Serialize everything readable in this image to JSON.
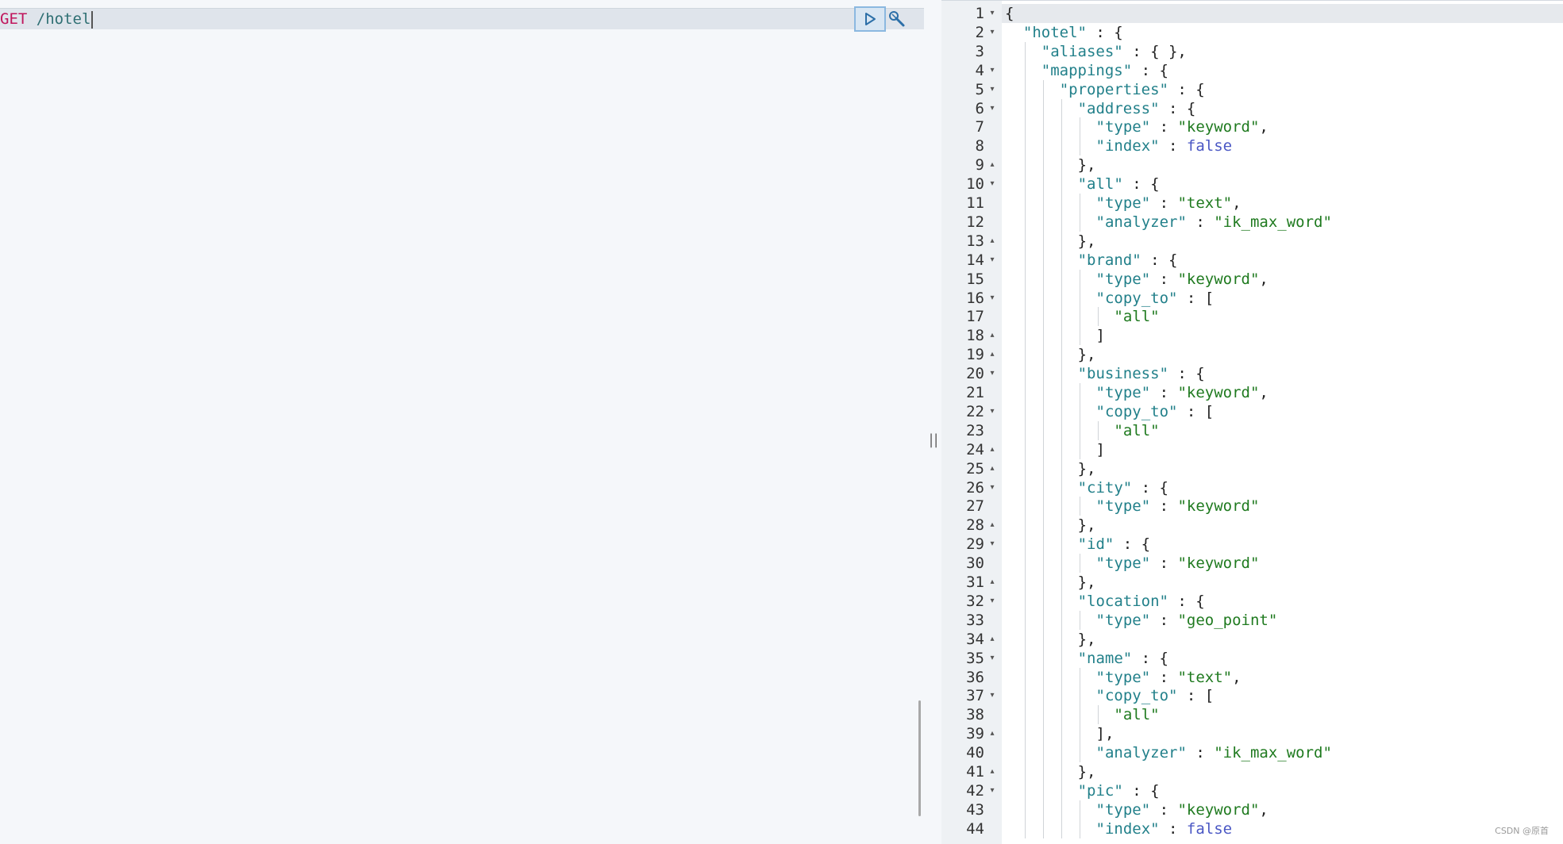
{
  "request": {
    "method": "GET",
    "path": "/hotel"
  },
  "toolbar": {
    "run_icon": "play-icon",
    "settings_icon": "wrench-icon"
  },
  "splitter": {
    "grip": "||"
  },
  "response": {
    "lines": [
      {
        "n": "1",
        "fold": "down",
        "indent": 0,
        "tokens": [
          [
            "pun",
            "{"
          ]
        ]
      },
      {
        "n": "2",
        "fold": "down",
        "indent": 1,
        "tokens": [
          [
            "key",
            "\"hotel\""
          ],
          [
            "pun",
            " : {"
          ]
        ]
      },
      {
        "n": "3",
        "fold": "",
        "indent": 2,
        "tokens": [
          [
            "key",
            "\"aliases\""
          ],
          [
            "pun",
            " : { },"
          ]
        ]
      },
      {
        "n": "4",
        "fold": "down",
        "indent": 2,
        "tokens": [
          [
            "key",
            "\"mappings\""
          ],
          [
            "pun",
            " : {"
          ]
        ]
      },
      {
        "n": "5",
        "fold": "down",
        "indent": 3,
        "tokens": [
          [
            "key",
            "\"properties\""
          ],
          [
            "pun",
            " : {"
          ]
        ]
      },
      {
        "n": "6",
        "fold": "down",
        "indent": 4,
        "tokens": [
          [
            "key",
            "\"address\""
          ],
          [
            "pun",
            " : {"
          ]
        ]
      },
      {
        "n": "7",
        "fold": "",
        "indent": 5,
        "tokens": [
          [
            "key",
            "\"type\""
          ],
          [
            "pun",
            " : "
          ],
          [
            "str",
            "\"keyword\""
          ],
          [
            "pun",
            ","
          ]
        ]
      },
      {
        "n": "8",
        "fold": "",
        "indent": 5,
        "tokens": [
          [
            "key",
            "\"index\""
          ],
          [
            "pun",
            " : "
          ],
          [
            "bool",
            "false"
          ]
        ]
      },
      {
        "n": "9",
        "fold": "up",
        "indent": 4,
        "tokens": [
          [
            "pun",
            "},"
          ]
        ]
      },
      {
        "n": "10",
        "fold": "down",
        "indent": 4,
        "tokens": [
          [
            "key",
            "\"all\""
          ],
          [
            "pun",
            " : {"
          ]
        ]
      },
      {
        "n": "11",
        "fold": "",
        "indent": 5,
        "tokens": [
          [
            "key",
            "\"type\""
          ],
          [
            "pun",
            " : "
          ],
          [
            "str",
            "\"text\""
          ],
          [
            "pun",
            ","
          ]
        ]
      },
      {
        "n": "12",
        "fold": "",
        "indent": 5,
        "tokens": [
          [
            "key",
            "\"analyzer\""
          ],
          [
            "pun",
            " : "
          ],
          [
            "str",
            "\"ik_max_word\""
          ]
        ]
      },
      {
        "n": "13",
        "fold": "up",
        "indent": 4,
        "tokens": [
          [
            "pun",
            "},"
          ]
        ]
      },
      {
        "n": "14",
        "fold": "down",
        "indent": 4,
        "tokens": [
          [
            "key",
            "\"brand\""
          ],
          [
            "pun",
            " : {"
          ]
        ]
      },
      {
        "n": "15",
        "fold": "",
        "indent": 5,
        "tokens": [
          [
            "key",
            "\"type\""
          ],
          [
            "pun",
            " : "
          ],
          [
            "str",
            "\"keyword\""
          ],
          [
            "pun",
            ","
          ]
        ]
      },
      {
        "n": "16",
        "fold": "down",
        "indent": 5,
        "tokens": [
          [
            "key",
            "\"copy_to\""
          ],
          [
            "pun",
            " : ["
          ]
        ]
      },
      {
        "n": "17",
        "fold": "",
        "indent": 6,
        "tokens": [
          [
            "str",
            "\"all\""
          ]
        ]
      },
      {
        "n": "18",
        "fold": "up",
        "indent": 5,
        "tokens": [
          [
            "pun",
            "]"
          ]
        ]
      },
      {
        "n": "19",
        "fold": "up",
        "indent": 4,
        "tokens": [
          [
            "pun",
            "},"
          ]
        ]
      },
      {
        "n": "20",
        "fold": "down",
        "indent": 4,
        "tokens": [
          [
            "key",
            "\"business\""
          ],
          [
            "pun",
            " : {"
          ]
        ]
      },
      {
        "n": "21",
        "fold": "",
        "indent": 5,
        "tokens": [
          [
            "key",
            "\"type\""
          ],
          [
            "pun",
            " : "
          ],
          [
            "str",
            "\"keyword\""
          ],
          [
            "pun",
            ","
          ]
        ]
      },
      {
        "n": "22",
        "fold": "down",
        "indent": 5,
        "tokens": [
          [
            "key",
            "\"copy_to\""
          ],
          [
            "pun",
            " : ["
          ]
        ]
      },
      {
        "n": "23",
        "fold": "",
        "indent": 6,
        "tokens": [
          [
            "str",
            "\"all\""
          ]
        ]
      },
      {
        "n": "24",
        "fold": "up",
        "indent": 5,
        "tokens": [
          [
            "pun",
            "]"
          ]
        ]
      },
      {
        "n": "25",
        "fold": "up",
        "indent": 4,
        "tokens": [
          [
            "pun",
            "},"
          ]
        ]
      },
      {
        "n": "26",
        "fold": "down",
        "indent": 4,
        "tokens": [
          [
            "key",
            "\"city\""
          ],
          [
            "pun",
            " : {"
          ]
        ]
      },
      {
        "n": "27",
        "fold": "",
        "indent": 5,
        "tokens": [
          [
            "key",
            "\"type\""
          ],
          [
            "pun",
            " : "
          ],
          [
            "str",
            "\"keyword\""
          ]
        ]
      },
      {
        "n": "28",
        "fold": "up",
        "indent": 4,
        "tokens": [
          [
            "pun",
            "},"
          ]
        ]
      },
      {
        "n": "29",
        "fold": "down",
        "indent": 4,
        "tokens": [
          [
            "key",
            "\"id\""
          ],
          [
            "pun",
            " : {"
          ]
        ]
      },
      {
        "n": "30",
        "fold": "",
        "indent": 5,
        "tokens": [
          [
            "key",
            "\"type\""
          ],
          [
            "pun",
            " : "
          ],
          [
            "str",
            "\"keyword\""
          ]
        ]
      },
      {
        "n": "31",
        "fold": "up",
        "indent": 4,
        "tokens": [
          [
            "pun",
            "},"
          ]
        ]
      },
      {
        "n": "32",
        "fold": "down",
        "indent": 4,
        "tokens": [
          [
            "key",
            "\"location\""
          ],
          [
            "pun",
            " : {"
          ]
        ]
      },
      {
        "n": "33",
        "fold": "",
        "indent": 5,
        "tokens": [
          [
            "key",
            "\"type\""
          ],
          [
            "pun",
            " : "
          ],
          [
            "str",
            "\"geo_point\""
          ]
        ]
      },
      {
        "n": "34",
        "fold": "up",
        "indent": 4,
        "tokens": [
          [
            "pun",
            "},"
          ]
        ]
      },
      {
        "n": "35",
        "fold": "down",
        "indent": 4,
        "tokens": [
          [
            "key",
            "\"name\""
          ],
          [
            "pun",
            " : {"
          ]
        ]
      },
      {
        "n": "36",
        "fold": "",
        "indent": 5,
        "tokens": [
          [
            "key",
            "\"type\""
          ],
          [
            "pun",
            " : "
          ],
          [
            "str",
            "\"text\""
          ],
          [
            "pun",
            ","
          ]
        ]
      },
      {
        "n": "37",
        "fold": "down",
        "indent": 5,
        "tokens": [
          [
            "key",
            "\"copy_to\""
          ],
          [
            "pun",
            " : ["
          ]
        ]
      },
      {
        "n": "38",
        "fold": "",
        "indent": 6,
        "tokens": [
          [
            "str",
            "\"all\""
          ]
        ]
      },
      {
        "n": "39",
        "fold": "up",
        "indent": 5,
        "tokens": [
          [
            "pun",
            "],"
          ]
        ]
      },
      {
        "n": "40",
        "fold": "",
        "indent": 5,
        "tokens": [
          [
            "key",
            "\"analyzer\""
          ],
          [
            "pun",
            " : "
          ],
          [
            "str",
            "\"ik_max_word\""
          ]
        ]
      },
      {
        "n": "41",
        "fold": "up",
        "indent": 4,
        "tokens": [
          [
            "pun",
            "},"
          ]
        ]
      },
      {
        "n": "42",
        "fold": "down",
        "indent": 4,
        "tokens": [
          [
            "key",
            "\"pic\""
          ],
          [
            "pun",
            " : {"
          ]
        ]
      },
      {
        "n": "43",
        "fold": "",
        "indent": 5,
        "tokens": [
          [
            "key",
            "\"type\""
          ],
          [
            "pun",
            " : "
          ],
          [
            "str",
            "\"keyword\""
          ],
          [
            "pun",
            ","
          ]
        ]
      },
      {
        "n": "44",
        "fold": "",
        "indent": 5,
        "tokens": [
          [
            "key",
            "\"index\""
          ],
          [
            "pun",
            " : "
          ],
          [
            "bool",
            "false"
          ]
        ]
      }
    ]
  },
  "watermark": "CSDN @原首"
}
